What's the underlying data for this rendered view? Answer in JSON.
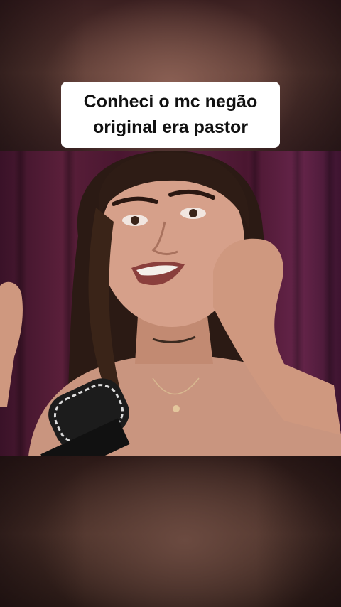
{
  "caption": {
    "line1": "Conheci o mc negão",
    "line2": "original era pastor"
  },
  "colors": {
    "curtain": "#5a1f3a",
    "caption_bg": "#ffffff",
    "caption_text": "#111111"
  }
}
